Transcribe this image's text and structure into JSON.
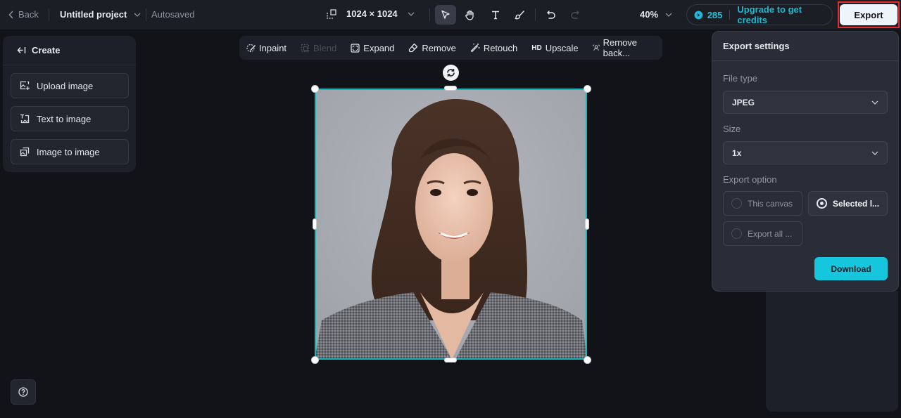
{
  "topbar": {
    "back_label": "Back",
    "project_title": "Untitled project",
    "save_status": "Autosaved",
    "canvas_size": "1024 × 1024",
    "zoom_level": "40%",
    "credits": "285",
    "upgrade_label": "Upgrade to get credits",
    "export_label": "Export",
    "tools": [
      {
        "name": "select-tool",
        "icon": "pointer-icon",
        "active": true
      },
      {
        "name": "hand-tool",
        "icon": "hand-icon",
        "active": false
      },
      {
        "name": "text-tool",
        "icon": "text-icon",
        "active": false
      },
      {
        "name": "brush-tool",
        "icon": "brush-icon",
        "active": false
      },
      {
        "name": "undo",
        "icon": "undo-icon",
        "active": false
      },
      {
        "name": "redo",
        "icon": "redo-icon",
        "active": false,
        "disabled": true
      }
    ]
  },
  "left_panel": {
    "header": "Create",
    "items": [
      {
        "label": "Upload image",
        "icon": "upload-image-icon"
      },
      {
        "label": "Text to image",
        "icon": "text-to-image-icon"
      },
      {
        "label": "Image to image",
        "icon": "image-to-image-icon"
      }
    ]
  },
  "context_toolbar": {
    "items": [
      {
        "label": "Inpaint",
        "icon": "inpaint-icon",
        "disabled": false
      },
      {
        "label": "Blend",
        "icon": "blend-icon",
        "disabled": true
      },
      {
        "label": "Expand",
        "icon": "expand-icon",
        "disabled": false
      },
      {
        "label": "Remove",
        "icon": "eraser-icon",
        "disabled": false
      },
      {
        "label": "Retouch",
        "icon": "magic-wand-icon",
        "disabled": false
      },
      {
        "label": "Upscale",
        "icon": "hd-icon",
        "icon_text": "HD",
        "disabled": false
      },
      {
        "label": "Remove back...",
        "icon": "remove-background-icon",
        "disabled": false
      }
    ]
  },
  "canvas": {
    "image_description": "Portrait of smiling woman with wavy brown hair in grey plaid blazer on grey background"
  },
  "export_settings": {
    "title": "Export settings",
    "file_type_label": "File type",
    "file_type_value": "JPEG",
    "size_label": "Size",
    "size_value": "1x",
    "export_option_label": "Export option",
    "options": [
      {
        "label": "This canvas",
        "selected": false
      },
      {
        "label": "Selected l...",
        "selected": true
      },
      {
        "label": "Export all ...",
        "selected": false
      }
    ],
    "download_label": "Download"
  },
  "colors": {
    "accent": "#16c6dc",
    "selection": "#19b4b8",
    "highlight_border": "#e52b2b"
  }
}
